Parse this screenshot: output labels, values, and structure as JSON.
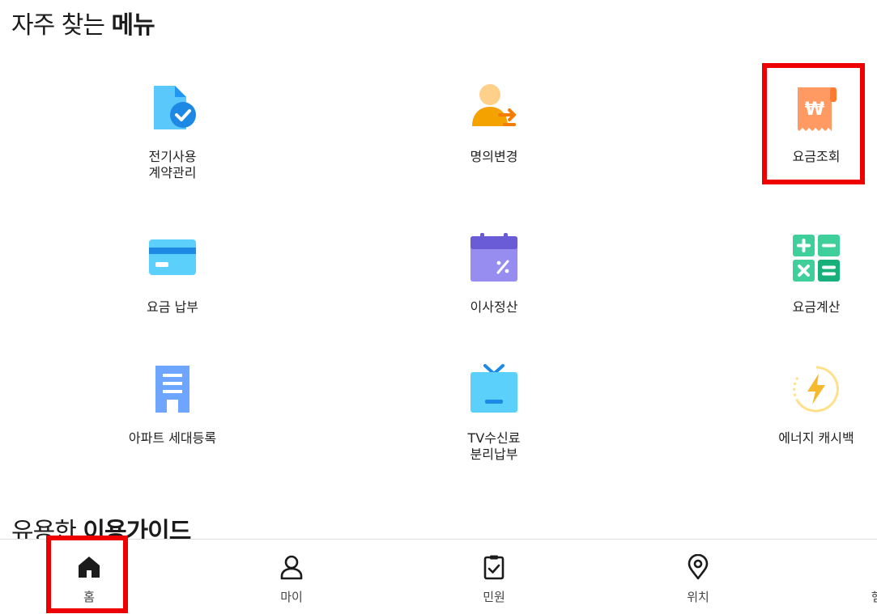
{
  "sections": {
    "frequent": {
      "prefix": "자주 찾는 ",
      "bold": "메뉴"
    },
    "guide": {
      "prefix": "유용한 ",
      "bold": "이용가이드"
    }
  },
  "menu": [
    {
      "label": "전기사용\n계약관리",
      "icon": "document-check-icon"
    },
    {
      "label": "명의변경",
      "icon": "person-transfer-icon"
    },
    {
      "label": "요금조회",
      "icon": "won-receipt-icon",
      "highlighted": true
    },
    {
      "label": "요금 납부",
      "icon": "credit-card-icon"
    },
    {
      "label": "이사정산",
      "icon": "calendar-percent-icon"
    },
    {
      "label": "요금계산",
      "icon": "calculator-icon"
    },
    {
      "label": "아파트 세대등록",
      "icon": "apartment-building-icon"
    },
    {
      "label": "TV수신료\n분리납부",
      "icon": "tv-icon"
    },
    {
      "label": "에너지 캐시백",
      "icon": "lightning-cashback-icon"
    }
  ],
  "bottom_nav": [
    {
      "label": "홈",
      "icon": "home-icon",
      "active": true
    },
    {
      "label": "마이",
      "icon": "person-icon"
    },
    {
      "label": "민원",
      "icon": "clipboard-check-icon"
    },
    {
      "label": "위치",
      "icon": "location-pin-icon"
    },
    {
      "label": "햄",
      "icon": "menu-icon"
    }
  ],
  "colors": {
    "highlight": "#ee0000",
    "doc_blue": "#5ac8fa",
    "receipt_orange": "#ff9a62",
    "card_blue": "#5bd0fa",
    "calendar_purple": "#8b7fe8",
    "calc_green": "#3ecf9a",
    "building_blue": "#6ea6ff",
    "bolt_yellow": "#f5b82e"
  }
}
